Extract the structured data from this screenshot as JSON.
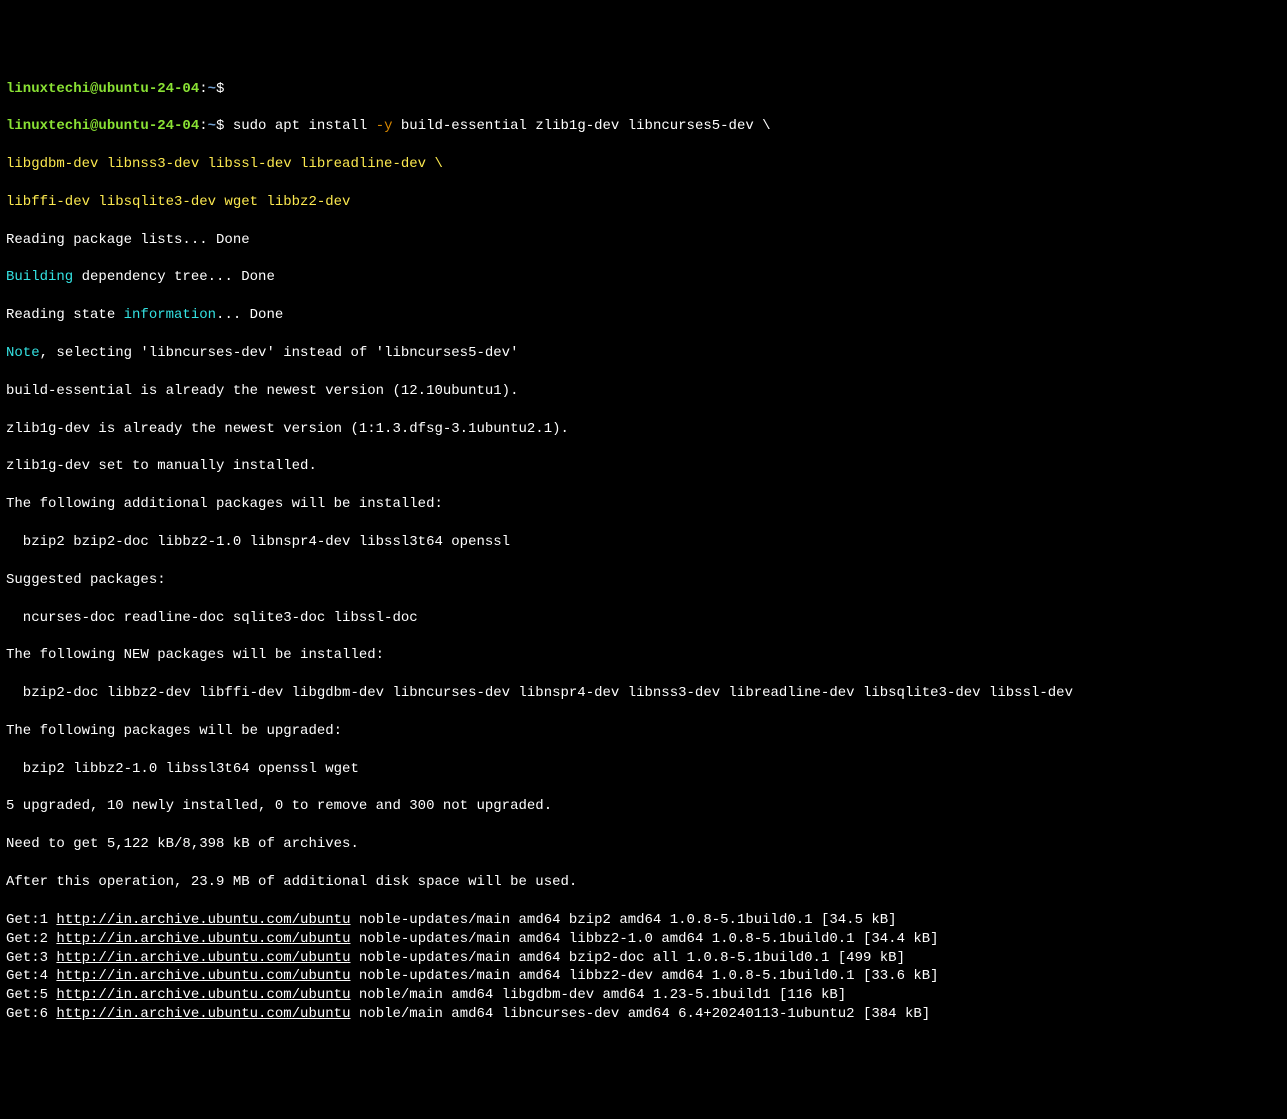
{
  "prompt1": {
    "user": "linuxtechi@ubuntu-24-04",
    "sep": ":",
    "path": "~",
    "dollar": "$"
  },
  "prompt2": {
    "user": "linuxtechi@ubuntu-24-04",
    "sep": ":",
    "path": "~",
    "dollar": "$",
    "cmd_pre": " sudo apt install ",
    "cmd_flag": "-y",
    "cmd_post": " build-essential zlib1g-dev libncurses5-dev \\"
  },
  "cont1": "libgdbm-dev libnss3-dev libssl-dev libreadline-dev \\",
  "cont2": "libffi-dev libsqlite3-dev wget libbz2-dev",
  "l_read_pkg": "Reading package lists... Done",
  "l_building": "Building",
  "l_building_rest": " dependency tree... Done",
  "l_read_state_pre": "Reading state ",
  "l_read_state_info": "information",
  "l_read_state_post": "... Done",
  "l_note": "Note",
  "l_note_rest": ", selecting 'libncurses-dev' instead of 'libncurses5-dev'",
  "l_build_ess": "build-essential is already the newest version (12.10ubuntu1).",
  "l_zlib": "zlib1g-dev is already the newest version (1:1.3.dfsg-3.1ubuntu2.1).",
  "l_zlib_set": "zlib1g-dev set to manually installed.",
  "l_additional": "The following additional packages will be installed:",
  "l_additional_list": "  bzip2 bzip2-doc libbz2-1.0 libnspr4-dev libssl3t64 openssl",
  "l_suggested": "Suggested packages:",
  "l_suggested_list": "  ncurses-doc readline-doc sqlite3-doc libssl-doc",
  "l_new": "The following NEW packages will be installed:",
  "l_new_list": "  bzip2-doc libbz2-dev libffi-dev libgdbm-dev libncurses-dev libnspr4-dev libnss3-dev libreadline-dev libsqlite3-dev libssl-dev",
  "l_upgraded": "The following packages will be upgraded:",
  "l_upgraded_list": "  bzip2 libbz2-1.0 libssl3t64 openssl wget",
  "l_summary": "5 upgraded, 10 newly installed, 0 to remove and 300 not upgraded.",
  "l_need": "Need to get 5,122 kB/8,398 kB of archives.",
  "l_after": "After this operation, 23.9 MB of additional disk space will be used.",
  "gets": [
    {
      "pre": "Get:1 ",
      "url": "http://in.archive.ubuntu.com/ubuntu",
      "post": " noble-updates/main amd64 bzip2 amd64 1.0.8-5.1build0.1 [34.5 kB]"
    },
    {
      "pre": "Get:2 ",
      "url": "http://in.archive.ubuntu.com/ubuntu",
      "post": " noble-updates/main amd64 libbz2-1.0 amd64 1.0.8-5.1build0.1 [34.4 kB]"
    },
    {
      "pre": "Get:3 ",
      "url": "http://in.archive.ubuntu.com/ubuntu",
      "post": " noble-updates/main amd64 bzip2-doc all 1.0.8-5.1build0.1 [499 kB]"
    },
    {
      "pre": "Get:4 ",
      "url": "http://in.archive.ubuntu.com/ubuntu",
      "post": " noble-updates/main amd64 libbz2-dev amd64 1.0.8-5.1build0.1 [33.6 kB]"
    },
    {
      "pre": "Get:5 ",
      "url": "http://in.archive.ubuntu.com/ubuntu",
      "post": " noble/main amd64 libgdbm-dev amd64 1.23-5.1build1 [116 kB]"
    },
    {
      "pre": "Get:6 ",
      "url": "http://in.archive.ubuntu.com/ubuntu",
      "post": " noble/main amd64 libncurses-dev amd64 6.4+20240113-1ubuntu2 [384 kB]"
    }
  ]
}
